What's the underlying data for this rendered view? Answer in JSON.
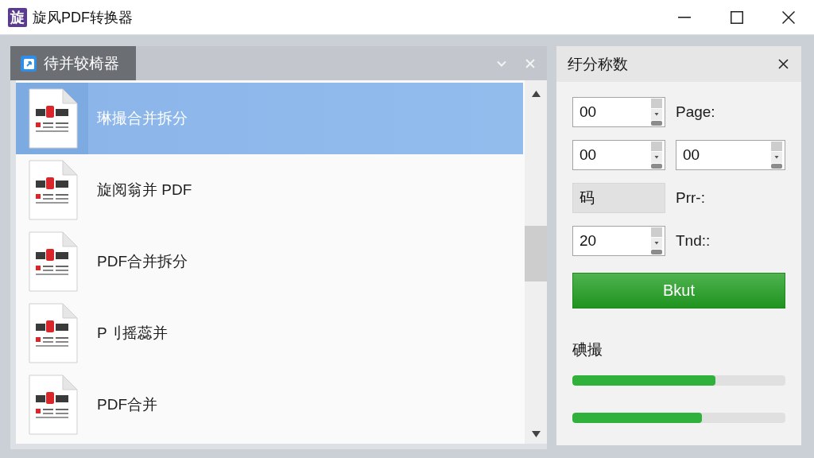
{
  "window": {
    "logo_text": "旋",
    "title": "旋风PDF转换器"
  },
  "list_panel": {
    "title": "待并较椅器",
    "items": [
      {
        "label": "琳撮合并拆分",
        "selected": true
      },
      {
        "label": "旋阅翁并 PDF",
        "selected": false
      },
      {
        "label": "PDF合并拆分",
        "selected": false
      },
      {
        "label": "P刂摇蕊并",
        "selected": false
      },
      {
        "label": "PDF合并",
        "selected": false
      }
    ]
  },
  "settings_panel": {
    "title": "纡分称数",
    "rows": [
      {
        "fields": [
          {
            "kind": "spin",
            "value": "00",
            "disabled": false
          }
        ],
        "label": "Page:"
      },
      {
        "fields": [
          {
            "kind": "spin",
            "value": "00",
            "disabled": false
          },
          {
            "kind": "spin",
            "value": "00",
            "disabled": false
          }
        ]
      },
      {
        "fields": [
          {
            "kind": "text",
            "value": "码",
            "disabled": true
          }
        ],
        "label": "Prr-:"
      },
      {
        "fields": [
          {
            "kind": "spin",
            "value": "20",
            "disabled": false
          }
        ],
        "label": "Tnd::"
      }
    ],
    "button": "Bkut",
    "progress": {
      "label": "碘撮",
      "bars": [
        {
          "level": 0.67
        },
        {
          "level": 0.61
        }
      ]
    }
  }
}
